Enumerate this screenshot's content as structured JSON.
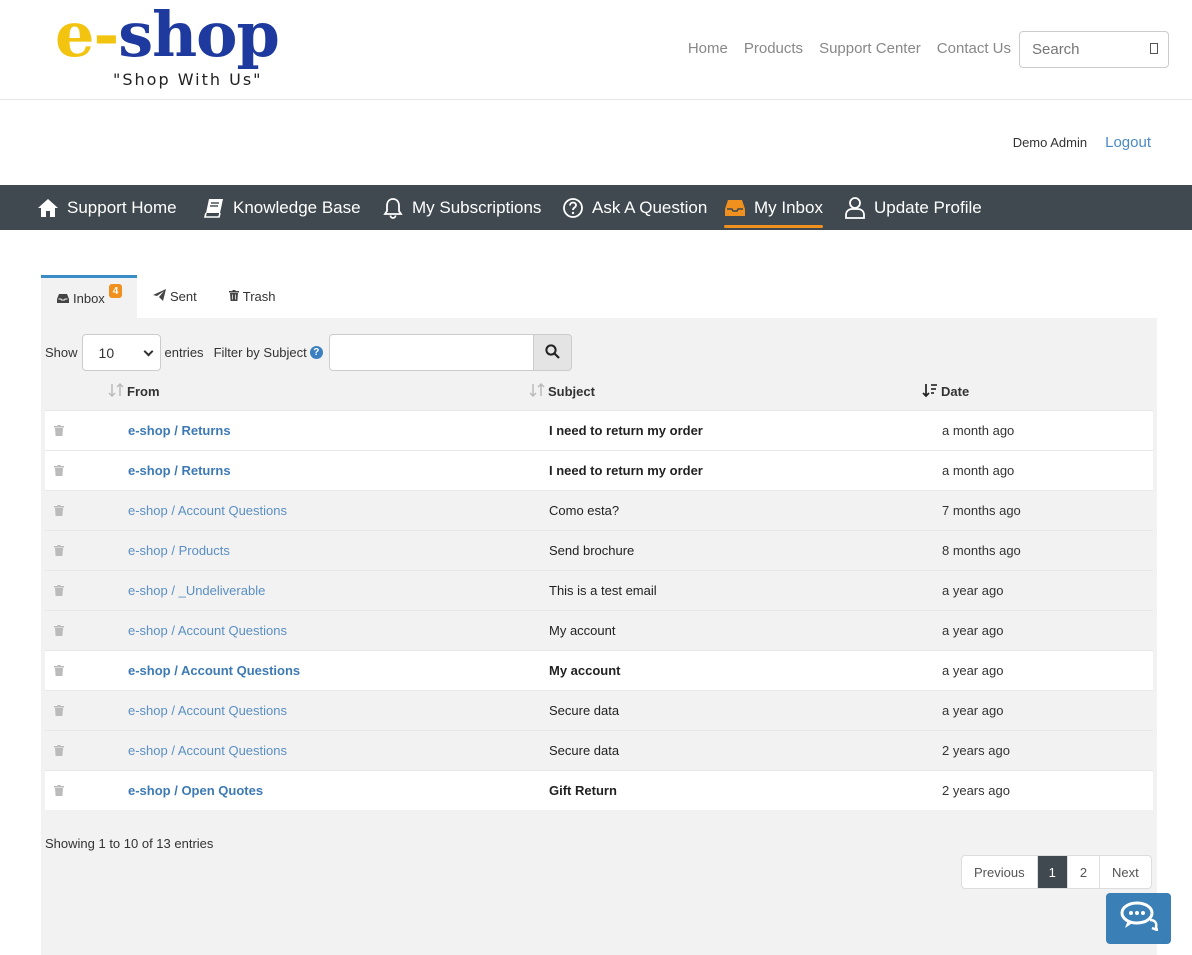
{
  "logo": {
    "prefix": "e-",
    "name": "shop",
    "tagline": "\"Shop With Us\""
  },
  "topnav": [
    {
      "label": "Home"
    },
    {
      "label": "Products"
    },
    {
      "label": "Support Center"
    },
    {
      "label": "Contact Us"
    }
  ],
  "search": {
    "placeholder": "Search"
  },
  "user": {
    "name": "Demo Admin",
    "logout": "Logout"
  },
  "mainnav": [
    {
      "label": "Support Home",
      "icon": "home-icon"
    },
    {
      "label": "Knowledge Base",
      "icon": "book-icon"
    },
    {
      "label": "My Subscriptions",
      "icon": "bell-icon"
    },
    {
      "label": "Ask A Question",
      "icon": "question-circle-icon"
    },
    {
      "label": "My Inbox",
      "icon": "inbox-icon",
      "active": true
    },
    {
      "label": "Update Profile",
      "icon": "user-icon"
    }
  ],
  "tabs": [
    {
      "label": "Inbox",
      "badge": "4",
      "active": true
    },
    {
      "label": "Sent"
    },
    {
      "label": "Trash"
    }
  ],
  "controls": {
    "show_label": "Show",
    "page_length": "10",
    "entries_label": "entries",
    "filter_label": "Filter by Subject",
    "filter_value": ""
  },
  "table": {
    "headers": {
      "from": "From",
      "subject": "Subject",
      "date": "Date"
    },
    "rows": [
      {
        "from": "e-shop / Returns",
        "subject": "I need to return my order",
        "date": "a month ago",
        "unread": true
      },
      {
        "from": "e-shop / Returns",
        "subject": "I need to return my order",
        "date": "a month ago",
        "unread": true
      },
      {
        "from": "e-shop / Account Questions",
        "subject": "Como esta?",
        "date": "7 months ago",
        "unread": false
      },
      {
        "from": "e-shop / Products",
        "subject": "Send brochure",
        "date": "8 months ago",
        "unread": false
      },
      {
        "from": "e-shop / _Undeliverable",
        "subject": "This is a test email",
        "date": "a year ago",
        "unread": false
      },
      {
        "from": "e-shop / Account Questions",
        "subject": "My account",
        "date": "a year ago",
        "unread": false
      },
      {
        "from": "e-shop / Account Questions",
        "subject": "My account",
        "date": "a year ago",
        "unread": true
      },
      {
        "from": "e-shop / Account Questions",
        "subject": "Secure data",
        "date": "a year ago",
        "unread": false
      },
      {
        "from": "e-shop / Account Questions",
        "subject": "Secure data",
        "date": "2 years ago",
        "unread": false
      },
      {
        "from": "e-shop / Open Quotes",
        "subject": "Gift Return",
        "date": "2 years ago",
        "unread": true
      }
    ]
  },
  "info": "Showing 1 to 10 of 13 entries",
  "pager": {
    "previous": "Previous",
    "pages": [
      "1",
      "2"
    ],
    "current": "1",
    "next": "Next"
  },
  "colors": {
    "nav_bg": "#3f494f",
    "accent": "#f0901e",
    "link": "#3d7ab5",
    "logo_e": "#f2c40f",
    "logo_shop": "#1e3a9e"
  }
}
